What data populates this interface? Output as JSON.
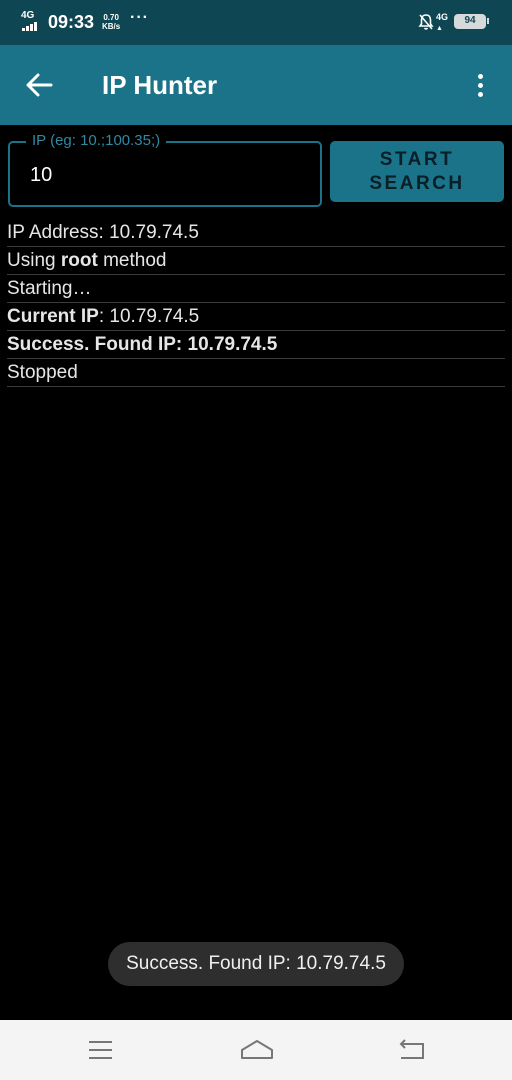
{
  "status_bar": {
    "network": "4G",
    "time": "09:33",
    "speed_value": "0.70",
    "speed_unit": "KB/s",
    "more": "···",
    "network_right": "4G",
    "battery": "94",
    "icons": [
      "signal-icon",
      "bell-off-icon",
      "battery-icon"
    ]
  },
  "app_bar": {
    "title": "IP Hunter",
    "back_icon": "arrow-left-icon",
    "menu_icon": "more-vert-icon"
  },
  "form": {
    "ip_label": "IP (eg: 10.;100.35;)",
    "ip_value": "10",
    "start_label_line1": "START",
    "start_label_line2": "SEARCH"
  },
  "log": {
    "line1": "IP Address: 10.79.74.5",
    "line2_prefix": "Using ",
    "line2_bold": "root",
    "line2_suffix": " method",
    "line3": "Starting…",
    "line4_label": "Current IP",
    "line4_value": ": 10.79.74.5",
    "line5": "Success. Found IP: 10.79.74.5",
    "line6": "Stopped"
  },
  "toast": {
    "message": "Success. Found IP: 10.79.74.5"
  },
  "nav_bar": {
    "icons": [
      "menu-icon",
      "home-icon",
      "back-icon"
    ]
  },
  "colors": {
    "status_bar": "#0f4653",
    "app_bar": "#1b7389",
    "accent": "#2f8aa3",
    "background": "#000000",
    "nav_bar": "#f4f4f4"
  }
}
